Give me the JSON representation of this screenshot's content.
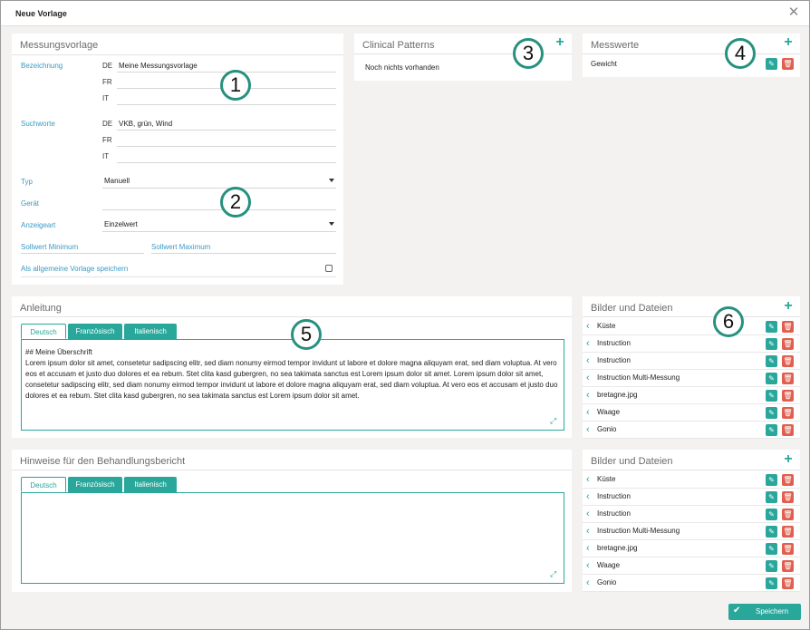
{
  "window": {
    "title": "Neue Vorlage",
    "close_label": "✕"
  },
  "vorlage": {
    "title": "Messungsvorlage",
    "bezeichnung_label": "Bezeichnung",
    "langs": [
      "DE",
      "FR",
      "IT"
    ],
    "bezeichnung_values": [
      "Meine Messungsvorlage",
      "",
      ""
    ],
    "suchworte_label": "Suchworte",
    "suchworte_values": [
      "VKB, grün, Wind",
      "",
      ""
    ],
    "typ_label": "Typ",
    "typ_value": "Manuell",
    "geraet_label": "Gerät",
    "geraet_value": "",
    "anzeigeart_label": "Anzeigeart",
    "anzeigeart_value": "Einzelwert",
    "sollwert_min_label": "Sollwert Minimum",
    "sollwert_max_label": "Sollwert Maximum",
    "allgemein_label": "Als allgemeine Vorlage speichern",
    "allgemein_checked": false
  },
  "clinical": {
    "title": "Clinical Patterns",
    "add": "+",
    "empty": "Noch nichts vorhanden"
  },
  "messwerte": {
    "title": "Messwerte",
    "add": "+",
    "items": [
      "Gewicht"
    ]
  },
  "anleitung": {
    "title": "Anleitung",
    "tabs": [
      "Deutsch",
      "Französisch",
      "Italienisch"
    ],
    "heading": "## Meine Überschrift",
    "body": "Lorem ipsum dolor sit amet, consetetur sadipscing elitr, sed diam nonumy eirmod tempor invidunt ut labore et dolore magna aliquyam erat, sed diam voluptua. At vero eos et accusam et justo duo dolores et ea rebum. Stet clita kasd gubergren, no sea takimata sanctus est Lorem ipsum dolor sit amet. Lorem ipsum dolor sit amet, consetetur sadipscing elitr, sed diam nonumy eirmod tempor invidunt ut labore et dolore magna aliquyam erat, sed diam voluptua. At vero eos et accusam et justo duo dolores et ea rebum. Stet clita kasd gubergren, no sea takimata sanctus est Lorem ipsum dolor sit amet."
  },
  "hinweise": {
    "title": "Hinweise für den Behandlungsbericht",
    "tabs": [
      "Deutsch",
      "Französisch",
      "Italienisch"
    ],
    "body": ""
  },
  "dateien1": {
    "title": "Bilder und Dateien",
    "add": "+",
    "items": [
      "Küste",
      "Instruction",
      "Instruction",
      "Instruction Multi-Messung",
      "bretagne.jpg",
      "Waage",
      "Gonio"
    ]
  },
  "dateien2": {
    "title": "Bilder und Dateien",
    "add": "+",
    "items": [
      "Küste",
      "Instruction",
      "Instruction",
      "Instruction Multi-Messung",
      "bretagne.jpg",
      "Waage",
      "Gonio"
    ]
  },
  "badges": [
    "1",
    "2",
    "3",
    "4",
    "5",
    "6"
  ],
  "icons": {
    "edit": "pencil-icon",
    "delete": "trash-icon",
    "chevron": "chevron-left-icon",
    "expand": "expand-icon",
    "save": "check-icon"
  },
  "colors": {
    "accent": "#2aa79b",
    "danger": "#e0604f",
    "label": "#3b9ac4",
    "badge_ring": "#27917f"
  },
  "footer": {
    "save_label": "Speichern"
  }
}
